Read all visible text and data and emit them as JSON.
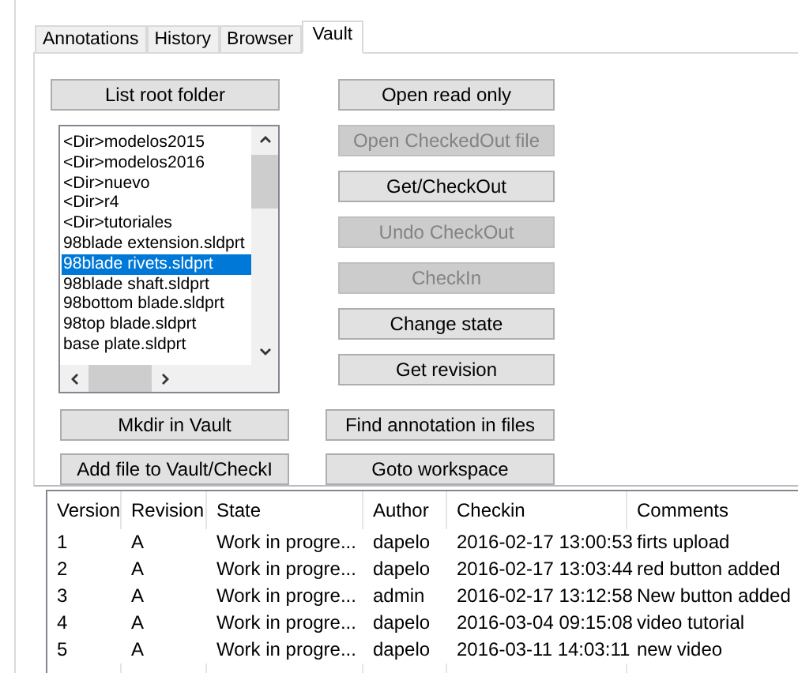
{
  "tabs": [
    {
      "label": "Annotations",
      "selected": false
    },
    {
      "label": "History",
      "selected": false
    },
    {
      "label": "Browser",
      "selected": false
    },
    {
      "label": "Vault",
      "selected": true
    }
  ],
  "left_buttons_top": [
    {
      "label": "List root folder",
      "disabled": false
    }
  ],
  "file_list": {
    "items": [
      {
        "label": "<Dir>modelos2015",
        "selected": false
      },
      {
        "label": "<Dir>modelos2016",
        "selected": false
      },
      {
        "label": "<Dir>nuevo",
        "selected": false
      },
      {
        "label": "<Dir>r4",
        "selected": false
      },
      {
        "label": "<Dir>tutoriales",
        "selected": false
      },
      {
        "label": "98blade extension.sldprt",
        "selected": false
      },
      {
        "label": "98blade rivets.sldprt",
        "selected": true
      },
      {
        "label": "98blade shaft.sldprt",
        "selected": false
      },
      {
        "label": "98bottom blade.sldprt",
        "selected": false
      },
      {
        "label": "98top blade.sldprt",
        "selected": false
      },
      {
        "label": "base plate.sldprt",
        "selected": false
      }
    ]
  },
  "right_buttons": [
    {
      "label": "Open read only",
      "disabled": false
    },
    {
      "label": "Open CheckedOut file",
      "disabled": true
    },
    {
      "label": "Get/CheckOut",
      "disabled": false
    },
    {
      "label": "Undo CheckOut",
      "disabled": true
    },
    {
      "label": "CheckIn",
      "disabled": true
    },
    {
      "label": "Change state",
      "disabled": false
    },
    {
      "label": "Get revision",
      "disabled": false
    }
  ],
  "left_buttons_bottom": [
    {
      "label": "Mkdir in Vault",
      "disabled": false
    },
    {
      "label": "Add file to Vault/CheckI",
      "disabled": false
    }
  ],
  "right_buttons_bottom": [
    {
      "label": "Find annotation in files",
      "disabled": false
    },
    {
      "label": "Goto workspace",
      "disabled": false
    }
  ],
  "table": {
    "columns": [
      "Version",
      "Revision",
      "State",
      "Author",
      "Checkin",
      "Comments"
    ],
    "rows": [
      [
        "1",
        "A",
        "Work in progre...",
        "dapelo",
        "2016-02-17 13:00:53",
        "firts upload"
      ],
      [
        "2",
        "A",
        "Work in progre...",
        "dapelo",
        "2016-02-17 13:03:44",
        "red button added"
      ],
      [
        "3",
        "A",
        "Work in progre...",
        "admin",
        "2016-02-17 13:12:58",
        "New button added"
      ],
      [
        "4",
        "A",
        "Work in progre...",
        "dapelo",
        "2016-03-04 09:15:08",
        "video tutorial"
      ],
      [
        "5",
        "A",
        "Work in progre...",
        "dapelo",
        "2016-03-11 14:03:11",
        "new video"
      ]
    ]
  }
}
